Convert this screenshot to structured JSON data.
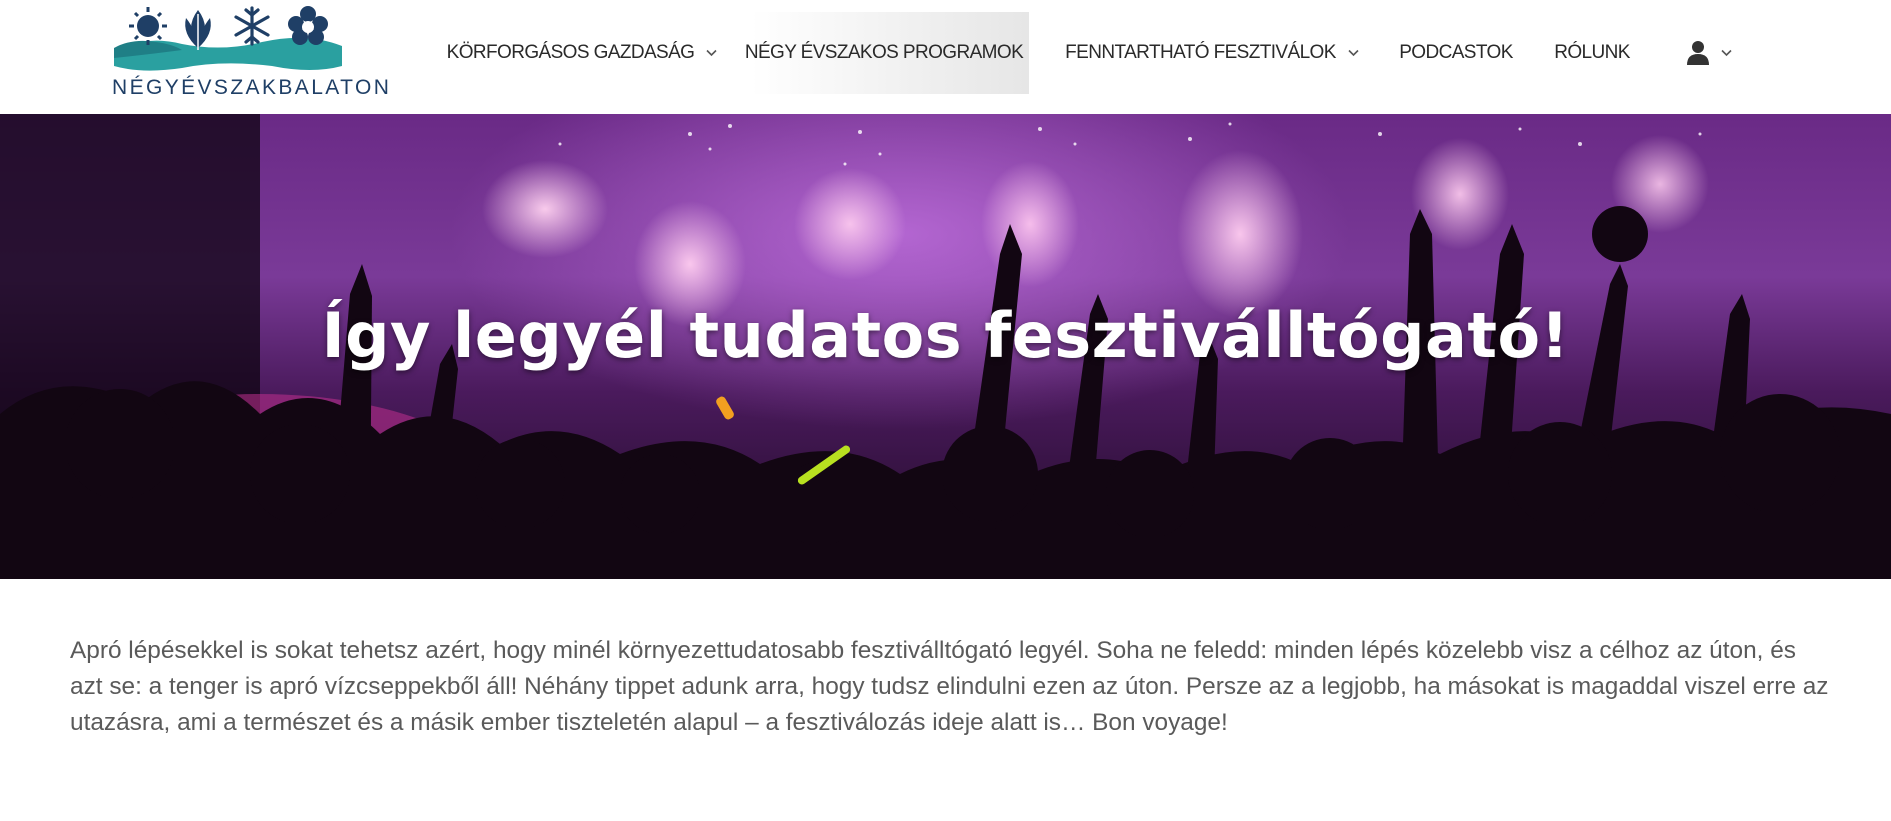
{
  "header": {
    "logo_text": "NÉGYÉVSZAKBALATON",
    "nav": [
      {
        "label": "KÖRFORGÁSOS GAZDASÁG",
        "has_dropdown": true,
        "active": false
      },
      {
        "label": "NÉGY ÉVSZAKOS PROGRAMOK",
        "has_dropdown": true,
        "active": true
      },
      {
        "label": "FENNTARTHATÓ FESZTIVÁLOK",
        "has_dropdown": true,
        "active": false
      },
      {
        "label": "PODCASTOK",
        "has_dropdown": false,
        "active": false
      },
      {
        "label": "RÓLUNK",
        "has_dropdown": false,
        "active": false
      }
    ],
    "user_menu_icon": "user-icon"
  },
  "hero": {
    "title": "Így legyél tudatos fesztiválltógató!"
  },
  "intro": {
    "text": "Apró lépésekkel is sokat tehetsz azért, hogy minél környezettudatosabb fesztiválltógató legyél. Soha ne feledd: minden lépés közelebb visz a célhoz az úton, és azt se: a tenger is apró vízcseppekből áll! Néhány tippet adunk arra, hogy tudsz elindulni ezen az úton. Persze az a legjobb, ha másokat is magaddal viszel erre az utazásra, ami a természet és a másik ember tiszteletén alapul – a fesztiválozás ideje alatt is… Bon voyage!"
  },
  "colors": {
    "logo_navy": "#1f3f66",
    "logo_teal": "#2aa0a0",
    "nav_text": "#2a2a2a",
    "body_text": "#5a5a5a"
  }
}
